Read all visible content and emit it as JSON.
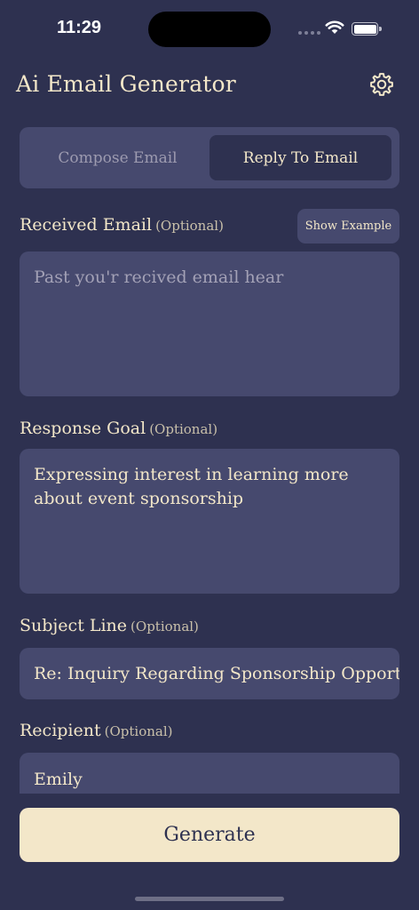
{
  "status_bar": {
    "time": "11:29"
  },
  "header": {
    "title": "Ai Email Generator",
    "settings_icon": "gear-icon"
  },
  "mode": {
    "options": [
      "Compose Email",
      "Reply To Email"
    ],
    "selected": "Reply To Email"
  },
  "received_email": {
    "label": "Received Email",
    "optional": "(Optional)",
    "show_example": "Show Example",
    "placeholder": "Past you'r recived email hear",
    "value": ""
  },
  "response_goal": {
    "label": "Response Goal",
    "optional": "(Optional)",
    "value": "Expressing interest in learning more about event sponsorship"
  },
  "subject_line": {
    "label": "Subject Line",
    "optional": "(Optional)",
    "value": "Re: Inquiry Regarding Sponsorship Opportu"
  },
  "recipient": {
    "label": "Recipient",
    "optional": "(Optional)",
    "value": "Emily"
  },
  "generate_label": "Generate",
  "colors": {
    "background": "#2e3150",
    "surface": "#46496e",
    "accent": "#f3e7c9"
  }
}
